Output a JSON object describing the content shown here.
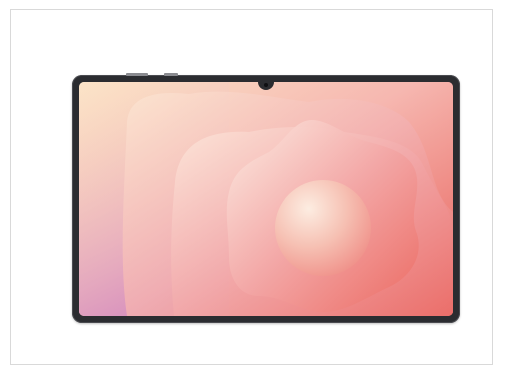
{
  "image": {
    "subject": "tablet-front-view",
    "wallpaper_colors": {
      "warm_cream": "#fbe2c8",
      "peach": "#f6c3bd",
      "pink": "#ef9aa6",
      "coral": "#ec7f84",
      "lavender": "#d9a2c9"
    },
    "bezel_color": "#2b2c30"
  }
}
